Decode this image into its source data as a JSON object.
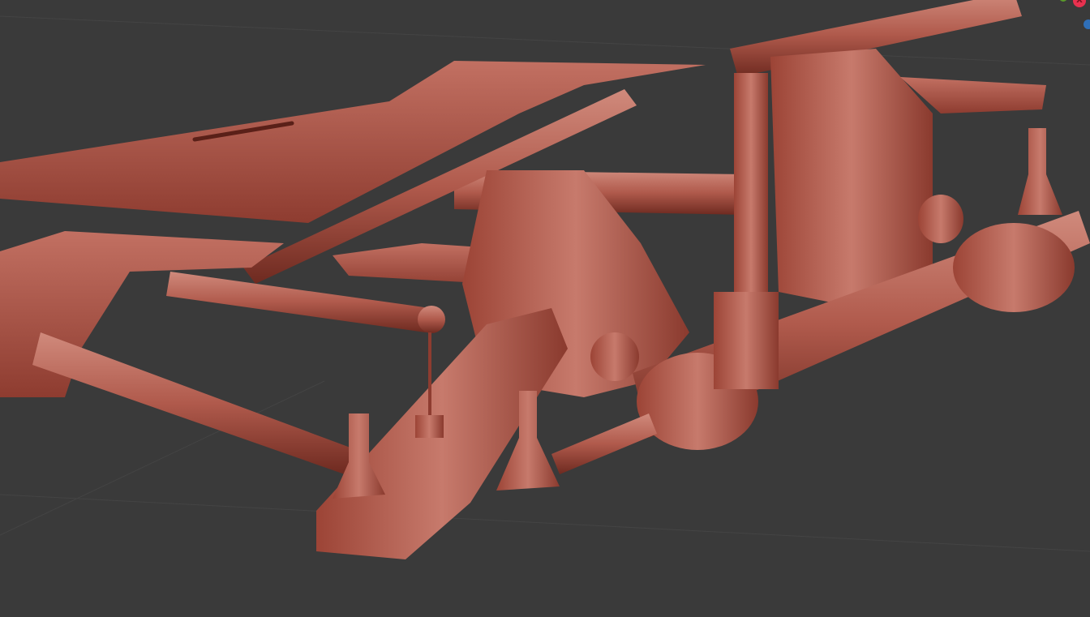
{
  "viewport": {
    "background": "#3a3a3a",
    "model_color": "#b45a4c"
  },
  "gizmo": {
    "x_label": "X",
    "x_color": "#e8314f",
    "y_color": "#5a9a2a",
    "z_color": "#2f6fb8"
  }
}
